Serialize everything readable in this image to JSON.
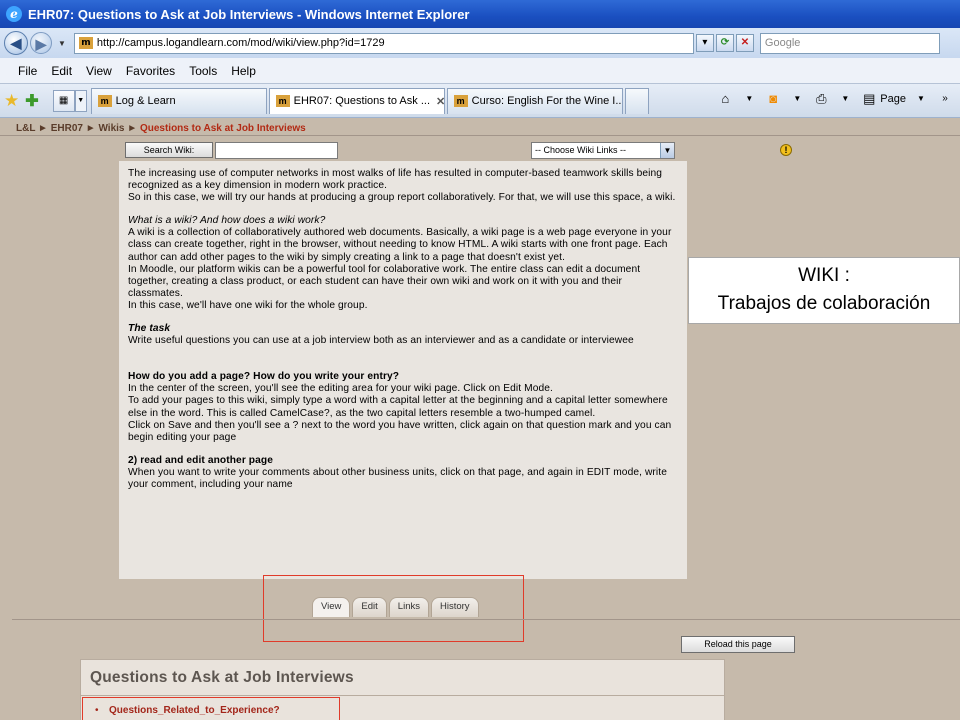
{
  "window": {
    "title": "EHR07: Questions to Ask at Job Interviews - Windows Internet Explorer"
  },
  "address_bar": {
    "url": "http://campus.logandlearn.com/mod/wiki/view.php?id=1729",
    "search_placeholder": "Google",
    "favicon": "m"
  },
  "menu": {
    "items": [
      "File",
      "Edit",
      "View",
      "Favorites",
      "Tools",
      "Help"
    ]
  },
  "tabs": {
    "items": [
      {
        "label": "Log & Learn"
      },
      {
        "label": "EHR07: Questions to Ask ..."
      },
      {
        "label": "Curso: English For the Wine I..."
      }
    ],
    "page_label": "Page"
  },
  "breadcrumb": {
    "items": [
      "L&L",
      "EHR07",
      "Wikis"
    ],
    "current": "Questions to Ask at Job Interviews",
    "separator": "►"
  },
  "wiki_controls": {
    "search_button": "Search Wiki:",
    "links_select": "-- Choose Wiki Links --"
  },
  "content": {
    "p1": "The increasing use of computer networks in most walks of life has resulted in computer-based teamwork skills being recognized as a key dimension in modern work practice.",
    "p2": "So in this case, we will try our hands at producing a group report collaboratively. For that, we will use this space, a wiki.",
    "h_what": "What is a wiki? And how does a wiki work?",
    "p3": "A wiki is a collection of collaboratively authored web documents. Basically, a wiki page is a web page everyone in your class can create together, right in the browser, without needing to know HTML. A wiki starts with one front page. Each author can add other pages to the wiki by simply creating a link to a page that doesn't exist yet.",
    "p4": "In Moodle, our platform wikis can be a powerful tool for colaborative work. The entire class can edit a document together, creating a class product, or each student can have their own wiki and work on it with you and their classmates.",
    "p5": "In this case, we'll have one wiki for the whole group.",
    "h_task": "The task",
    "p6": "Write useful questions you can use at a job interview both as an interviewer and as a candidate or interviewee",
    "h_add": "How do you add a page? How do you write your entry?",
    "p7": "In the center of the screen, you'll see the editing area for your wiki page. Click on Edit Mode.",
    "p8": "To add your pages to this wiki, simply type a word with a capital letter at the beginning and a capital letter somewhere else in the word. This is called CamelCase?, as the two capital letters resemble a two-humped camel.",
    "p9": "Click on Save and then you'll see a ? next to the word you have written, click again on that question mark and you can begin editing your page",
    "h_read": "2) read and edit another page",
    "p10": "When you want to write your comments about other business units, click on that page, and again in EDIT mode, write your comment, including your name"
  },
  "overlay": {
    "line1": "WIKI :",
    "line2": "Trabajos de colaboración"
  },
  "bottom_tabs": [
    "View",
    "Edit",
    "Links",
    "History"
  ],
  "reload_button": "Reload this page",
  "questions_panel": {
    "title": "Questions to Ask at Job Interviews",
    "items": [
      "Questions_Related_to_Experience?"
    ]
  },
  "colors": {
    "accent_red": "#e03b2a",
    "link_red": "#a3261a",
    "page_bg": "#c6baab"
  }
}
